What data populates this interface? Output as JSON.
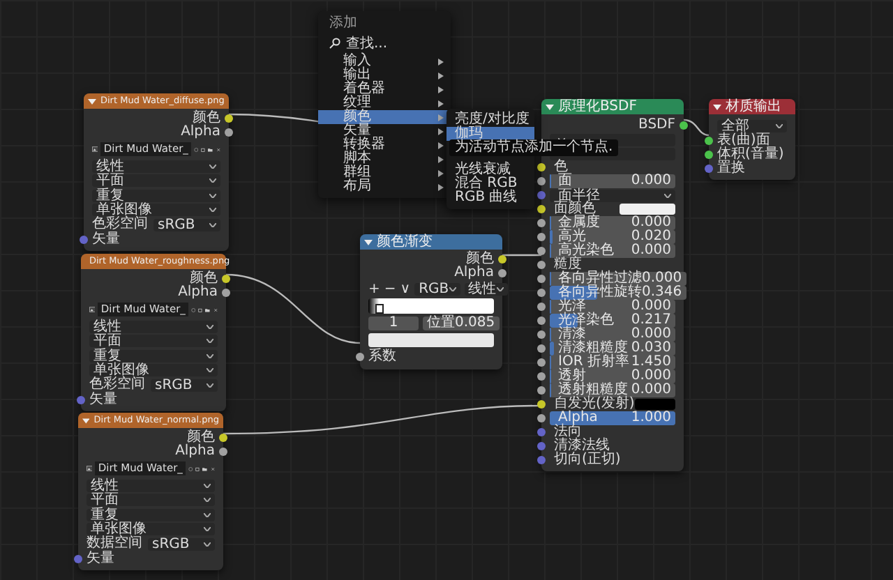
{
  "image_nodes": [
    {
      "title": "Dirt Mud Water_diffuse.png",
      "outputs": [
        {
          "label": "颜色",
          "color": "#c7c729"
        },
        {
          "label": "Alpha",
          "color": "#a1a1a1"
        }
      ],
      "image_name": "Dirt Mud Water_",
      "dropdowns": [
        "线性",
        "平面",
        "重复",
        "单张图像"
      ],
      "colorspace_label": "色彩空间",
      "colorspace_value": "sRGB",
      "input": {
        "label": "矢量",
        "color": "#6363c7"
      }
    },
    {
      "title": "Dirt Mud Water_roughness.png",
      "outputs": [
        {
          "label": "颜色",
          "color": "#c7c729"
        },
        {
          "label": "Alpha",
          "color": "#a1a1a1"
        }
      ],
      "image_name": "Dirt Mud Water_",
      "dropdowns": [
        "线性",
        "平面",
        "重复",
        "单张图像"
      ],
      "colorspace_label": "色彩空间",
      "colorspace_value": "sRGB",
      "input": {
        "label": "矢量",
        "color": "#6363c7"
      }
    },
    {
      "title": "Dirt Mud Water_normal.png",
      "outputs": [
        {
          "label": "颜色",
          "color": "#c7c729"
        },
        {
          "label": "Alpha",
          "color": "#a1a1a1"
        }
      ],
      "image_name": "Dirt Mud Water_",
      "dropdowns": [
        "线性",
        "平面",
        "重复",
        "单张图像"
      ],
      "colorspace_label": "数据空间",
      "colorspace_value": "sRGB",
      "input": {
        "label": "矢量",
        "color": "#6363c7"
      }
    }
  ],
  "color_ramp": {
    "title": "颜色渐变",
    "outputs": [
      {
        "label": "颜色",
        "color": "#c7c729"
      },
      {
        "label": "Alpha",
        "color": "#a1a1a1"
      }
    ],
    "tools": [
      "+",
      "−",
      "∨"
    ],
    "color_mode": "RGB",
    "interpolation": "线性",
    "stop_index": "1",
    "position_label": "位置",
    "position_value": "0.085",
    "input": {
      "label": "系数",
      "color": "#a1a1a1"
    }
  },
  "bsdf": {
    "title": "原理化BSDF",
    "rows": [
      {
        "kind": "output",
        "label": "BSDF",
        "socket": {
          "color": "#4bc24b"
        }
      },
      {
        "kind": "dropdown"
      },
      {
        "kind": "dropdown"
      },
      {
        "kind": "label",
        "label": "色",
        "socket": {
          "color": "#c7c729"
        }
      },
      {
        "kind": "value",
        "label": "面",
        "value": "0.000",
        "level": 0,
        "socket": {
          "color": "#a1a1a1"
        }
      },
      {
        "kind": "dropdown",
        "label": "面半径",
        "socket": {
          "color": "#6363c7"
        }
      },
      {
        "kind": "swatch",
        "label": "面颜色",
        "color": "#f0f0f0",
        "socket": {
          "color": "#c7c729"
        }
      },
      {
        "kind": "value",
        "label": "金属度",
        "value": "0.000",
        "level": 0,
        "socket": {
          "color": "#a1a1a1"
        }
      },
      {
        "kind": "value",
        "label": "高光",
        "value": "0.020",
        "level": 0.02,
        "socket": {
          "color": "#a1a1a1"
        }
      },
      {
        "kind": "value",
        "label": "高光染色",
        "value": "0.000",
        "level": 0,
        "socket": {
          "color": "#a1a1a1"
        }
      },
      {
        "kind": "label",
        "label": "糙度",
        "socket": {
          "color": "#a1a1a1"
        }
      },
      {
        "kind": "value",
        "label": "各向异性过滤",
        "value": "0.000",
        "level": 0,
        "socket": {
          "color": "#a1a1a1"
        }
      },
      {
        "kind": "value",
        "label": "各向异性旋转",
        "value": "0.346",
        "level": 0.346,
        "socket": {
          "color": "#a1a1a1"
        }
      },
      {
        "kind": "value",
        "label": "光泽",
        "value": "0.000",
        "level": 0,
        "socket": {
          "color": "#a1a1a1"
        }
      },
      {
        "kind": "value",
        "label": "光泽染色",
        "value": "0.217",
        "level": 0.217,
        "socket": {
          "color": "#a1a1a1"
        }
      },
      {
        "kind": "value",
        "label": "清漆",
        "value": "0.000",
        "level": 0,
        "socket": {
          "color": "#a1a1a1"
        }
      },
      {
        "kind": "value",
        "label": "清漆粗糙度",
        "value": "0.030",
        "level": 0.03,
        "socket": {
          "color": "#a1a1a1"
        }
      },
      {
        "kind": "value",
        "label": "IOR 折射率",
        "value": "1.450",
        "level": 0,
        "socket": {
          "color": "#a1a1a1"
        }
      },
      {
        "kind": "value",
        "label": "透射",
        "value": "0.000",
        "level": 0,
        "socket": {
          "color": "#a1a1a1"
        }
      },
      {
        "kind": "value",
        "label": "透射粗糙度",
        "value": "0.000",
        "level": 0,
        "socket": {
          "color": "#a1a1a1"
        }
      },
      {
        "kind": "swatch",
        "label": "自发光(发射)",
        "color": "#000000",
        "socket": {
          "color": "#c7c729"
        }
      },
      {
        "kind": "value",
        "label": "Alpha",
        "value": "1.000",
        "level": 1,
        "socket": {
          "color": "#a1a1a1"
        }
      },
      {
        "kind": "label",
        "label": "法向",
        "socket": {
          "color": "#6363c7"
        }
      },
      {
        "kind": "label",
        "label": "清漆法线",
        "socket": {
          "color": "#6363c7"
        }
      },
      {
        "kind": "label",
        "label": "切向(正切)",
        "socket": {
          "color": "#6363c7"
        }
      }
    ]
  },
  "material_output": {
    "title": "材质输出",
    "target": "全部",
    "inputs": [
      {
        "label": "表(曲)面",
        "color": "#4bc24b"
      },
      {
        "label": "体积(音量)",
        "color": "#4bc24b"
      },
      {
        "label": "置换",
        "color": "#6363c7"
      }
    ]
  },
  "add_menu": {
    "title": "添加",
    "search": "查找...",
    "items": [
      {
        "label": "输入",
        "selected": false
      },
      {
        "label": "输出",
        "selected": false
      },
      {
        "label": "着色器",
        "selected": false
      },
      {
        "label": "纹理",
        "selected": false
      },
      {
        "label": "颜色",
        "selected": true
      },
      {
        "label": "矢量",
        "selected": false
      },
      {
        "label": "转换器",
        "selected": false
      },
      {
        "label": "脚本",
        "selected": false
      },
      {
        "label": "群组",
        "selected": false
      },
      {
        "label": "布局",
        "selected": false
      }
    ]
  },
  "color_submenu": {
    "items": [
      {
        "label": "亮度/对比度",
        "selected": false
      },
      {
        "label": "伽玛",
        "selected": true
      },
      {
        "label": "光线衰减",
        "selected": false
      },
      {
        "label": "混合 RGB",
        "selected": false
      },
      {
        "label": "RGB 曲线",
        "selected": false
      }
    ],
    "tooltip": "为活动节点添加一个节点."
  }
}
